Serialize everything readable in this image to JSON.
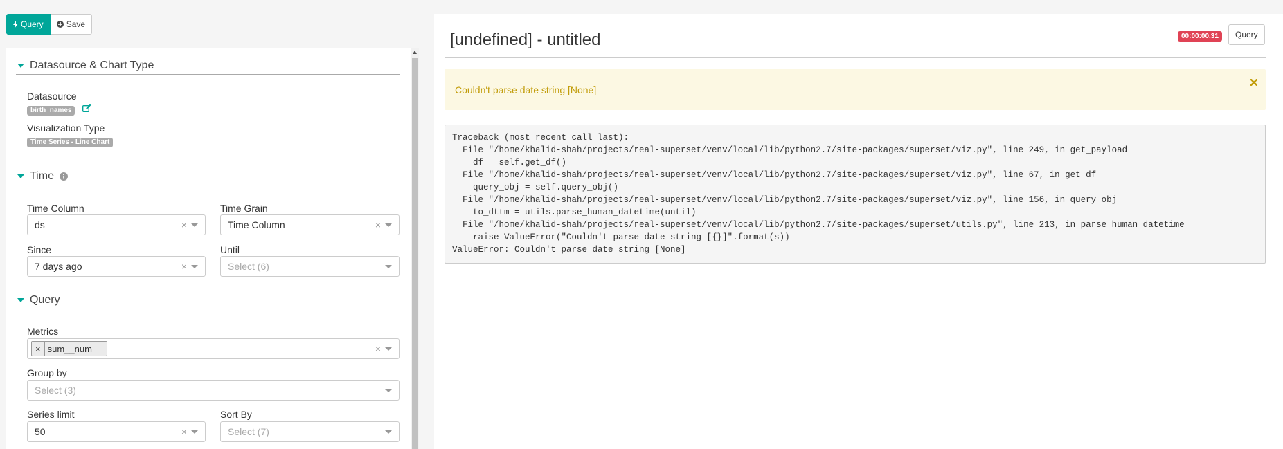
{
  "toolbar": {
    "query_label": "Query",
    "save_label": "Save"
  },
  "controls": {
    "datasource_section": {
      "title": "Datasource & Chart Type",
      "datasource_label": "Datasource",
      "datasource_value": "birth_names",
      "viz_type_label": "Visualization Type",
      "viz_type_value": "Time Series - Line Chart"
    },
    "time_section": {
      "title": "Time",
      "time_column": {
        "label": "Time Column",
        "value": "ds"
      },
      "time_grain": {
        "label": "Time Grain",
        "value": "Time Column"
      },
      "since": {
        "label": "Since",
        "value": "7 days ago"
      },
      "until": {
        "label": "Until",
        "placeholder": "Select (6)"
      }
    },
    "query_section": {
      "title": "Query",
      "metrics": {
        "label": "Metrics",
        "tags": [
          "sum__num"
        ]
      },
      "group_by": {
        "label": "Group by",
        "placeholder": "Select (3)"
      },
      "series_limit": {
        "label": "Series limit",
        "value": "50"
      },
      "sort_by": {
        "label": "Sort By",
        "placeholder": "Select (7)"
      }
    }
  },
  "result": {
    "title": "[undefined] - untitled",
    "timer": "00:00:00.31",
    "query_button": "Query",
    "alert_message": "Couldn't parse date string [None]",
    "traceback": [
      "Traceback (most recent call last):",
      "  File \"/home/khalid-shah/projects/real-superset/venv/local/lib/python2.7/site-packages/superset/viz.py\", line 249, in get_payload",
      "    df = self.get_df()",
      "  File \"/home/khalid-shah/projects/real-superset/venv/local/lib/python2.7/site-packages/superset/viz.py\", line 67, in get_df",
      "    query_obj = self.query_obj()",
      "  File \"/home/khalid-shah/projects/real-superset/venv/local/lib/python2.7/site-packages/superset/viz.py\", line 156, in query_obj",
      "    to_dttm = utils.parse_human_datetime(until)",
      "  File \"/home/khalid-shah/projects/real-superset/venv/local/lib/python2.7/site-packages/superset/utils.py\", line 213, in parse_human_datetime",
      "    raise ValueError(\"Couldn't parse date string [{}]\".format(s))",
      "ValueError: Couldn't parse date string [None]"
    ]
  },
  "colors": {
    "accent": "#00a699",
    "danger": "#e04355",
    "warning_bg": "#fcf8e3",
    "warning_text": "#c29d0b"
  }
}
